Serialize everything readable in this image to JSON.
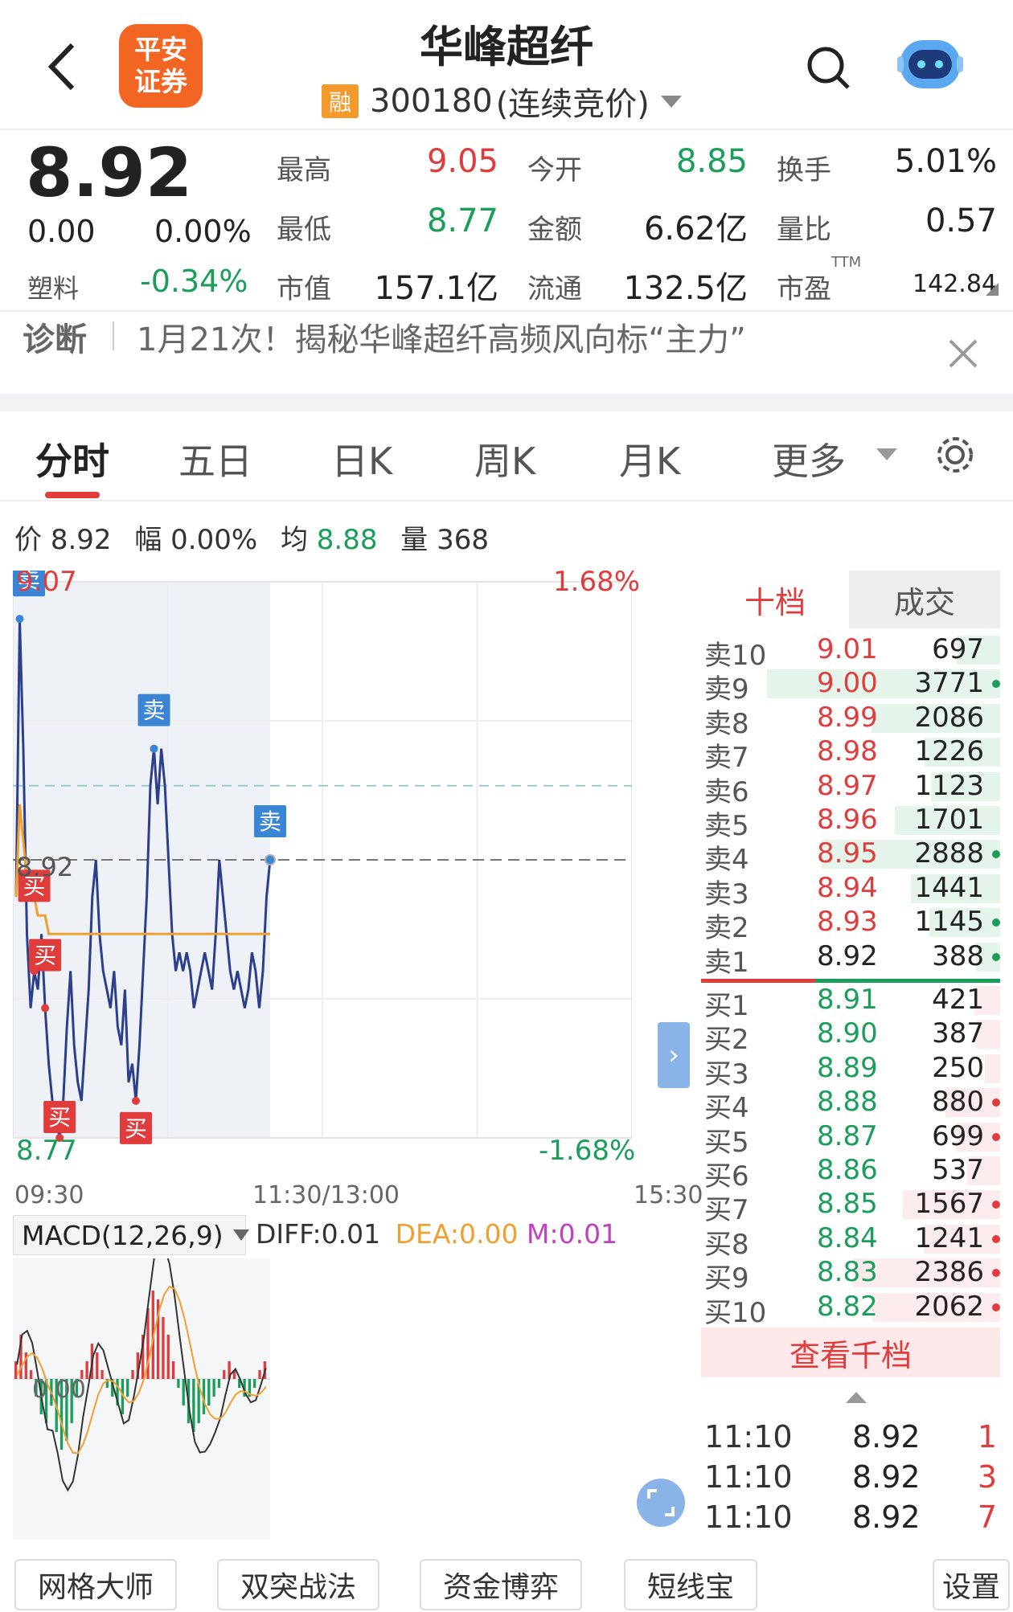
{
  "header": {
    "title": "华峰超纤",
    "broker_logo": "平安证券",
    "rong": "融",
    "code": "300180",
    "status": "(连续竞价)"
  },
  "quote": {
    "price": "8.92",
    "change": "0.00",
    "change_pct": "0.00%",
    "sector_label": "塑料",
    "sector_pct": "-0.34%",
    "fields": [
      {
        "label": "最高",
        "value": "9.05",
        "color": "#e03c3c"
      },
      {
        "label": "今开",
        "value": "8.85",
        "color": "#1a9e5a"
      },
      {
        "label": "换手",
        "value": "5.01%",
        "color": "#222222"
      },
      {
        "label": "最低",
        "value": "8.77",
        "color": "#1a9e5a"
      },
      {
        "label": "金额",
        "value": "6.62亿",
        "color": "#222222"
      },
      {
        "label": "量比",
        "value": "0.57",
        "color": "#222222"
      },
      {
        "label": "市值",
        "value": "157.1亿",
        "color": "#222222"
      },
      {
        "label": "流通",
        "value": "132.5亿",
        "color": "#222222"
      },
      {
        "label": "市盈",
        "value": "142.84",
        "color": "#222222"
      }
    ],
    "pe_tag": "TTM"
  },
  "diagnosis": {
    "label": "诊断",
    "text": "1月21次！揭秘华峰超纤高频风向标“主力”"
  },
  "tabs": [
    "分时",
    "五日",
    "日K",
    "周K",
    "月K",
    "更多"
  ],
  "info_bar": {
    "price_label": "价",
    "price": "8.92",
    "amp_label": "幅",
    "amp": "0.00%",
    "avg_label": "均",
    "avg": "8.88",
    "vol_label": "量",
    "vol": "368"
  },
  "chart_data": {
    "type": "line",
    "y_high": "9.07",
    "y_low": "8.77",
    "pct_high": "1.68%",
    "pct_low": "-1.68%",
    "ref_label": "8.92",
    "x_labels": [
      "09:30",
      "11:30/13:00",
      "15:30"
    ],
    "ylim": [
      8.77,
      9.07
    ],
    "grid": true,
    "series": [
      {
        "values": [
          8.9,
          9.05,
          8.98,
          8.88,
          8.84,
          8.86,
          8.85,
          8.88,
          8.84,
          8.81,
          8.79,
          8.78,
          8.77,
          8.79,
          8.83,
          8.86,
          8.82,
          8.8,
          8.79,
          8.82,
          8.85,
          8.9,
          8.92,
          8.88,
          8.86,
          8.85,
          8.84,
          8.86,
          8.83,
          8.82,
          8.85,
          8.8,
          8.81,
          8.79,
          8.82,
          8.86,
          8.9,
          8.96,
          8.98,
          8.95,
          8.98,
          8.96,
          8.92,
          8.88,
          8.86,
          8.87,
          8.86,
          8.87,
          8.86,
          8.84,
          8.85,
          8.86,
          8.87,
          8.86,
          8.85,
          8.88,
          8.92,
          8.9,
          8.88,
          8.86,
          8.85,
          8.86,
          8.85,
          8.84,
          8.85,
          8.87,
          8.86,
          8.84,
          8.86,
          8.9,
          8.92
        ]
      },
      {
        "values": [
          8.9,
          8.95,
          8.93,
          8.91,
          8.9,
          8.9,
          8.89,
          8.89,
          8.89,
          8.88,
          8.88,
          8.88,
          8.88,
          8.88,
          8.88,
          8.88,
          8.88,
          8.88,
          8.88,
          8.88,
          8.88,
          8.88,
          8.88,
          8.88,
          8.88,
          8.88,
          8.88,
          8.88,
          8.88,
          8.88,
          8.88,
          8.88,
          8.88,
          8.88,
          8.88,
          8.88,
          8.88,
          8.88,
          8.88,
          8.88,
          8.88,
          8.88,
          8.88,
          8.88,
          8.88,
          8.88,
          8.88,
          8.88,
          8.88,
          8.88,
          8.88,
          8.88,
          8.88,
          8.88,
          8.88,
          8.88,
          8.88,
          8.88,
          8.88,
          8.88,
          8.88,
          8.88,
          8.88,
          8.88,
          8.88,
          8.88,
          8.88,
          8.88,
          8.88,
          8.88,
          8.88
        ]
      }
    ],
    "markers": [
      {
        "label": "卖",
        "x_index": 1
      },
      {
        "label": "卖",
        "x_index": 38
      },
      {
        "label": "卖",
        "x_index": 70
      },
      {
        "label": "买",
        "x_index": 5
      },
      {
        "label": "买",
        "x_index": 8
      },
      {
        "label": "买",
        "x_index": 12
      },
      {
        "label": "买",
        "x_index": 33
      }
    ]
  },
  "macd": {
    "label": "MACD(12,26,9)",
    "diff": "DIFF:0.01",
    "dea": "DEA:0.00",
    "m": "M:0.01",
    "zero_label": "0.00",
    "bars": [
      0.02,
      0.05,
      0.03,
      0.01,
      -0.02,
      -0.04,
      -0.05,
      -0.03,
      -0.06,
      -0.08,
      -0.07,
      -0.05,
      -0.02,
      0.01,
      0.02,
      0.04,
      0.03,
      0.01,
      -0.01,
      -0.02,
      -0.03,
      -0.04,
      -0.02,
      0.01,
      0.03,
      0.05,
      0.08,
      0.1,
      0.09,
      0.07,
      0.05,
      0.02,
      -0.01,
      -0.03,
      -0.05,
      -0.06,
      -0.05,
      -0.04,
      -0.03,
      -0.02,
      -0.01,
      0.01,
      0.02,
      0.01,
      -0.01,
      -0.02,
      -0.02,
      -0.01,
      0.01,
      0.02
    ]
  },
  "orderbook": {
    "tab_active": "十档",
    "tab_other": "成交",
    "asks": [
      {
        "label": "卖10",
        "price": "9.01",
        "vol": "697",
        "dot": ""
      },
      {
        "label": "卖9",
        "price": "9.00",
        "vol": "3771",
        "dot": "#1a9e5a"
      },
      {
        "label": "卖8",
        "price": "8.99",
        "vol": "2086",
        "dot": ""
      },
      {
        "label": "卖7",
        "price": "8.98",
        "vol": "1226",
        "dot": ""
      },
      {
        "label": "卖6",
        "price": "8.97",
        "vol": "1123",
        "dot": ""
      },
      {
        "label": "卖5",
        "price": "8.96",
        "vol": "1701",
        "dot": ""
      },
      {
        "label": "卖4",
        "price": "8.95",
        "vol": "2888",
        "dot": "#1a9e5a"
      },
      {
        "label": "卖3",
        "price": "8.94",
        "vol": "1441",
        "dot": ""
      },
      {
        "label": "卖2",
        "price": "8.93",
        "vol": "1145",
        "dot": "#1a9e5a"
      },
      {
        "label": "卖1",
        "price": "8.92",
        "vol": "388",
        "dot": "#1a9e5a"
      }
    ],
    "bids": [
      {
        "label": "买1",
        "price": "8.91",
        "vol": "421",
        "dot": ""
      },
      {
        "label": "买2",
        "price": "8.90",
        "vol": "387",
        "dot": ""
      },
      {
        "label": "买3",
        "price": "8.89",
        "vol": "250",
        "dot": ""
      },
      {
        "label": "买4",
        "price": "8.88",
        "vol": "880",
        "dot": "#e03c3c"
      },
      {
        "label": "买5",
        "price": "8.87",
        "vol": "699",
        "dot": "#e03c3c"
      },
      {
        "label": "买6",
        "price": "8.86",
        "vol": "537",
        "dot": ""
      },
      {
        "label": "买7",
        "price": "8.85",
        "vol": "1567",
        "dot": "#e03c3c"
      },
      {
        "label": "买8",
        "price": "8.84",
        "vol": "1241",
        "dot": "#e03c3c"
      },
      {
        "label": "买9",
        "price": "8.83",
        "vol": "2386",
        "dot": "#e03c3c"
      },
      {
        "label": "买10",
        "price": "8.82",
        "vol": "2062",
        "dot": "#e03c3c"
      }
    ],
    "view_more": "查看千档",
    "ticks": [
      {
        "time": "11:10",
        "price": "8.92",
        "vol": "1"
      },
      {
        "time": "11:10",
        "price": "8.92",
        "vol": "3"
      },
      {
        "time": "11:10",
        "price": "8.92",
        "vol": "7"
      }
    ]
  },
  "bottom_buttons": [
    "网格大师",
    "双突战法",
    "资金博弈",
    "短线宝",
    "设置"
  ],
  "colors": {
    "up": "#e03c3c",
    "down": "#1a9e5a",
    "price_line": "#2b3f8c",
    "avg_line": "#f0a030",
    "accent_blue": "#3a86d4"
  }
}
